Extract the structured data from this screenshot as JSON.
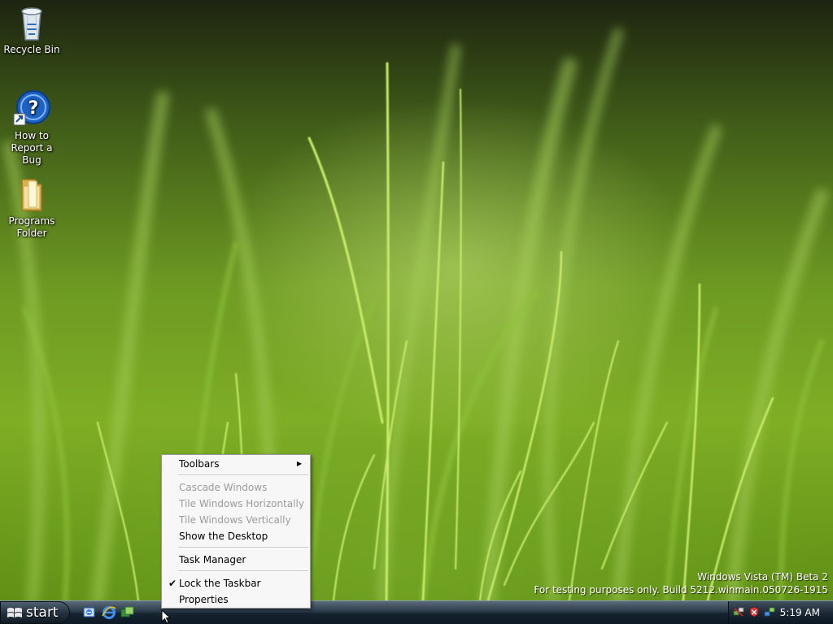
{
  "desktop": {
    "icons": [
      {
        "label": "Recycle Bin",
        "icon": "recycle-bin-icon"
      },
      {
        "label": "How to Report a Bug",
        "icon": "help-icon"
      },
      {
        "label": "Programs Folder",
        "icon": "folder-icon"
      }
    ],
    "watermark": {
      "line1": "Windows Vista (TM) Beta 2",
      "line2": "For testing purposes only. Build 5212.winmain.050726-1915"
    }
  },
  "context_menu": {
    "items": [
      {
        "label": "Toolbars",
        "enabled": true,
        "submenu": true
      },
      {
        "label": "Cascade Windows",
        "enabled": false
      },
      {
        "label": "Tile Windows Horizontally",
        "enabled": false
      },
      {
        "label": "Tile Windows Vertically",
        "enabled": false
      },
      {
        "label": "Show the Desktop",
        "enabled": true
      },
      {
        "label": "Task Manager",
        "enabled": true
      },
      {
        "label": "Lock the Taskbar",
        "enabled": true,
        "checked": true
      },
      {
        "label": "Properties",
        "enabled": true
      }
    ]
  },
  "taskbar": {
    "start_label": "start",
    "quick_launch": [
      "show-desktop-icon",
      "internet-explorer-icon",
      "switch-windows-icon"
    ],
    "tray_icons": [
      "network-icon",
      "security-shield-icon",
      "connection-icon"
    ],
    "clock": "5:19 AM"
  },
  "colors": {
    "taskbar": "#152330",
    "menu_bg": "#f7f7f7",
    "disabled_text": "#9b9b9b",
    "grass": "#7fae25"
  }
}
